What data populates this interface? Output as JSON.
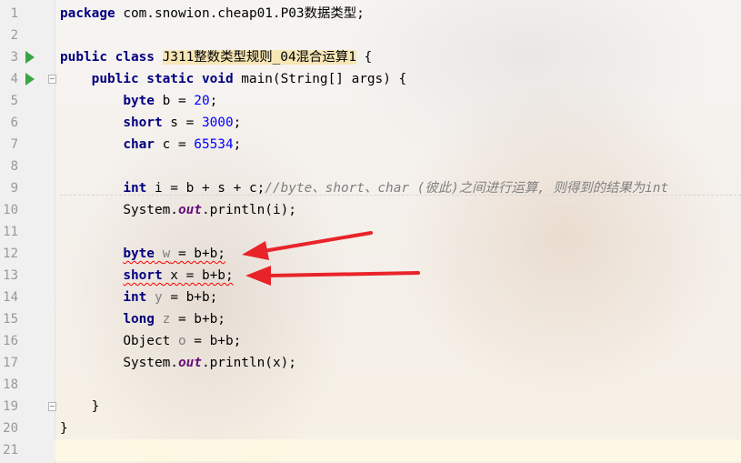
{
  "editor": {
    "lines": [
      {
        "n": "1",
        "code": "package com.snowion.cheap01.P03数据类型;"
      },
      {
        "n": "2",
        "code": ""
      },
      {
        "n": "3",
        "code": "public class J311整数类型规则_04混合运算1 {"
      },
      {
        "n": "4",
        "code": "    public static void main(String[] args) {"
      },
      {
        "n": "5",
        "code": "        byte b = 20;"
      },
      {
        "n": "6",
        "code": "        short s = 3000;"
      },
      {
        "n": "7",
        "code": "        char c = 65534;"
      },
      {
        "n": "8",
        "code": ""
      },
      {
        "n": "9",
        "code": "        int i = b + s + c;//byte、short、char (彼此)之间进行运算, 则得到的结果为int"
      },
      {
        "n": "10",
        "code": "        System.out.println(i);"
      },
      {
        "n": "11",
        "code": ""
      },
      {
        "n": "12",
        "code": "        byte w = b+b;"
      },
      {
        "n": "13",
        "code": "        short x = b+b;"
      },
      {
        "n": "14",
        "code": "        int y = b+b;"
      },
      {
        "n": "15",
        "code": "        long z = b+b;"
      },
      {
        "n": "16",
        "code": "        Object o = b+b;"
      },
      {
        "n": "17",
        "code": "        System.out.println(x);"
      },
      {
        "n": "18",
        "code": ""
      },
      {
        "n": "19",
        "code": "    }"
      },
      {
        "n": "20",
        "code": "}"
      },
      {
        "n": "21",
        "code": ""
      }
    ],
    "tokens": {
      "l1_kw": "package",
      "l1_rest": " com.snowion.cheap01.P03数据类型;",
      "l3_kw": "public class",
      "l3_cls": "J311整数类型规则_04混合运算1",
      "l3_rest": " {",
      "l4_kw": "public static void",
      "l4_rest": " main(String[] args) {",
      "l5_kw": "byte",
      "l5_a": " b = ",
      "l5_num": "20",
      "l5_end": ";",
      "l6_kw": "short",
      "l6_a": " s = ",
      "l6_num": "3000",
      "l6_end": ";",
      "l7_kw": "char",
      "l7_a": " c = ",
      "l7_num": "65534",
      "l7_end": ";",
      "l9_kw": "int",
      "l9_a": " i = b + s + c;",
      "l9_cmt": "//byte、short、char (彼此)之间进行运算, 则得到的结果为int",
      "l10_a": "System.",
      "l10_fld": "out",
      "l10_b": ".println(i);",
      "l12_kw": "byte",
      "l12_a": " ",
      "l12_var": "w",
      "l12_b": " = b+b;",
      "l13_kw": "short",
      "l13_a": " x = b+b;",
      "l14_kw": "int",
      "l14_a": " ",
      "l14_var": "y",
      "l14_b": " = b+b;",
      "l15_kw": "long",
      "l15_a": " ",
      "l15_var": "z",
      "l15_b": " = b+b;",
      "l16_a": "Object ",
      "l16_var": "o",
      "l16_b": " = b+b;",
      "l17_a": "System.",
      "l17_fld": "out",
      "l17_b": ".println(x);",
      "l19": "    }",
      "l20": "}"
    },
    "gutter": {
      "run_icons": [
        "3",
        "4"
      ],
      "fold_icons": [
        "4",
        "19"
      ]
    },
    "colors": {
      "keyword": "#000080",
      "number": "#0000ff",
      "static_field": "#660e7a",
      "comment": "#808080",
      "error_underline": "#ff0000",
      "annotation_arrow": "#e8242a",
      "run_icon": "#3aa444"
    }
  }
}
